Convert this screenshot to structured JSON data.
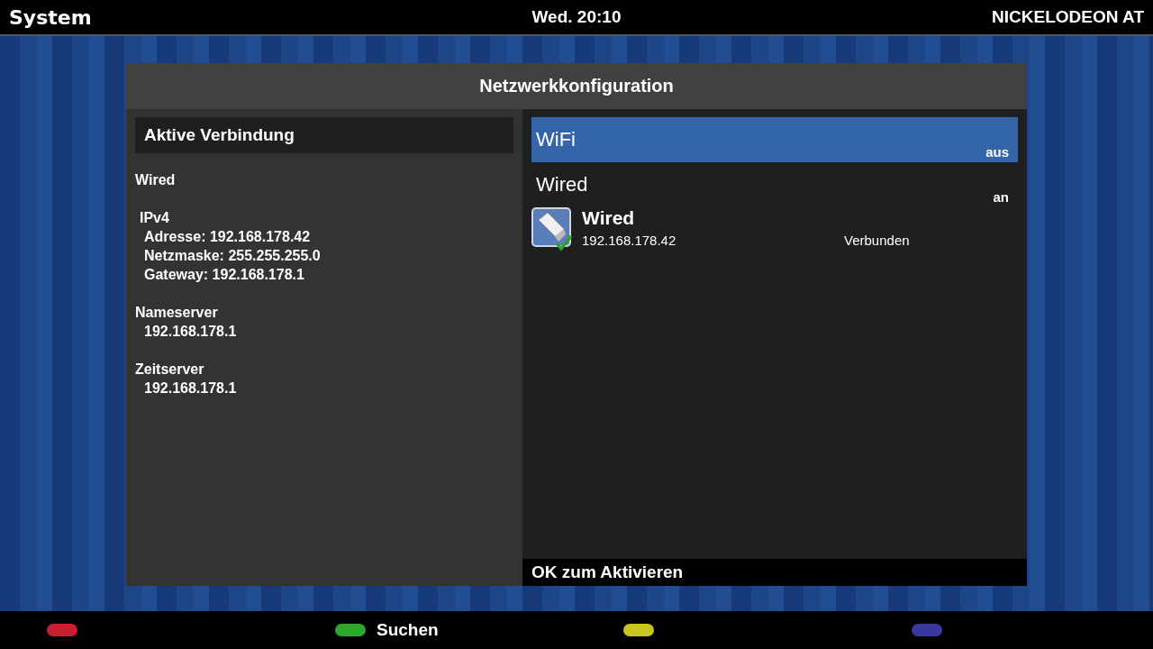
{
  "header": {
    "title": "System",
    "clock": "Wed. 20:10",
    "channel": "NICKELODEON AT"
  },
  "dialog": {
    "title": "Netzwerkkonfiguration",
    "active": {
      "heading": "Aktive Verbindung",
      "sections": [
        {
          "kind": "group",
          "title": "Wired"
        },
        {
          "kind": "subgroup",
          "title": "IPv4",
          "lines": [
            "Adresse: 192.168.178.42",
            "Netzmaske: 255.255.255.0",
            "Gateway: 192.168.178.1"
          ]
        },
        {
          "kind": "group",
          "title": "Nameserver",
          "lines": [
            "192.168.178.1"
          ]
        },
        {
          "kind": "group",
          "title": "Zeitserver",
          "lines": [
            "192.168.178.1"
          ]
        }
      ]
    },
    "technologies": [
      {
        "name": "WiFi",
        "state": "aus",
        "selected": true
      },
      {
        "name": "Wired",
        "state": "an",
        "selected": false,
        "services": [
          {
            "name": "Wired",
            "address": "192.168.178.42",
            "status": "Verbunden",
            "connected": true
          }
        ]
      }
    ],
    "hint": "OK zum Aktivieren"
  },
  "footer": [
    {
      "color": "#c8202e"
    },
    {
      "color": "#2ea82a",
      "label": "Suchen"
    },
    {
      "color": "#c8c420"
    },
    {
      "color": "#3838a0"
    }
  ]
}
